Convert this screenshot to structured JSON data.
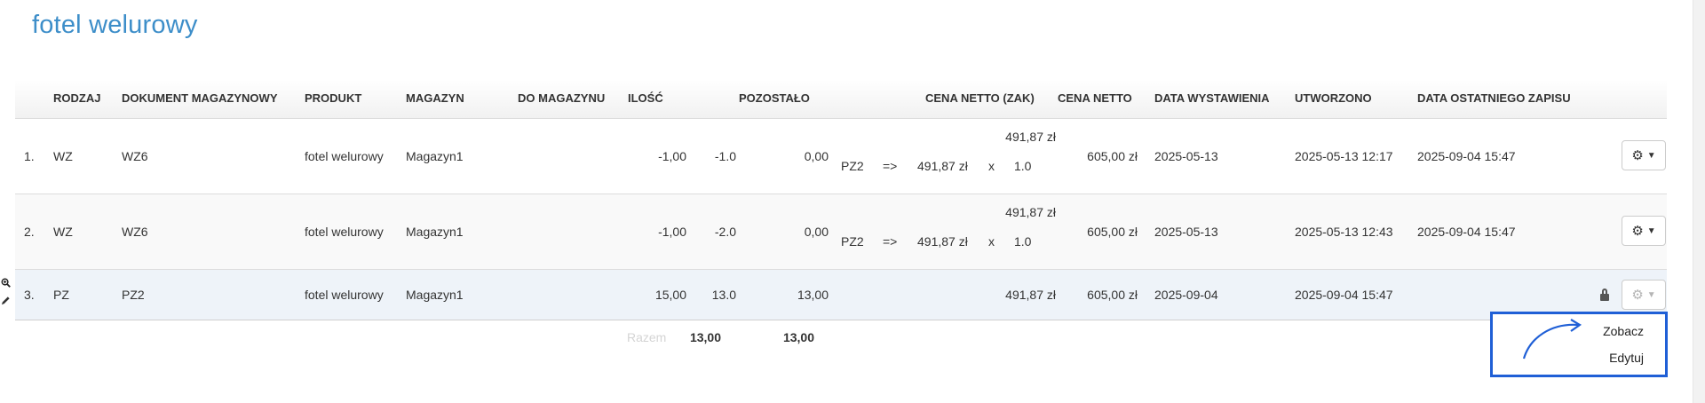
{
  "page_title": "fotel welurowy",
  "headers": {
    "rodzaj": "RODZAJ",
    "dokument": "DOKUMENT MAGAZYNOWY",
    "produkt": "PRODUKT",
    "magazyn": "MAGAZYN",
    "do_magazynu": "DO MAGAZYNU",
    "ilosc": "ILOŚĆ",
    "pozostalo": "POZOSTAŁO",
    "cena_zak": "CENA NETTO (ZAK)",
    "cena_netto": "CENA NETTO",
    "data_wystawienia": "DATA WYSTAWIENIA",
    "utworzono": "UTWORZONO",
    "data_zapisu": "DATA OSTATNIEGO ZAPISU"
  },
  "rows": [
    {
      "num": "1.",
      "rodzaj": "WZ",
      "dokument": "WZ6",
      "produkt": "fotel welurowy",
      "magazyn": "Magazyn1",
      "ilosc": "-1,00",
      "running": "-1.0",
      "pozostalo": "0,00",
      "zak_top": "491,87 zł",
      "zak_src": "PZ2",
      "zak_arrow": "=>",
      "zak_price": "491,87 zł",
      "zak_x": "x",
      "zak_qty": "1.0",
      "cena_netto": "605,00 zł",
      "data_wystawienia": "2025-05-13",
      "utworzono": "2025-05-13 12:17",
      "data_zapisu": "2025-09-04 15:47"
    },
    {
      "num": "2.",
      "rodzaj": "WZ",
      "dokument": "WZ6",
      "produkt": "fotel welurowy",
      "magazyn": "Magazyn1",
      "ilosc": "-1,00",
      "running": "-2.0",
      "pozostalo": "0,00",
      "zak_top": "491,87 zł",
      "zak_src": "PZ2",
      "zak_arrow": "=>",
      "zak_price": "491,87 zł",
      "zak_x": "x",
      "zak_qty": "1.0",
      "cena_netto": "605,00 zł",
      "data_wystawienia": "2025-05-13",
      "utworzono": "2025-05-13 12:43",
      "data_zapisu": "2025-09-04 15:47"
    },
    {
      "num": "3.",
      "rodzaj": "PZ",
      "dokument": "PZ2",
      "produkt": "fotel welurowy",
      "magazyn": "Magazyn1",
      "ilosc": "15,00",
      "running": "13.0",
      "pozostalo": "13,00",
      "zak_top": "491,87 zł",
      "cena_netto": "605,00 zł",
      "data_wystawienia": "2025-09-04",
      "utworzono": "2025-09-04 15:47",
      "data_zapisu": ""
    }
  ],
  "totals": {
    "label": "Razem",
    "running": "13,00",
    "pozostalo": "13,00"
  },
  "menu": {
    "zobacz": "Zobacz",
    "edytuj": "Edytuj"
  },
  "icons": {
    "actions": "gear-icon",
    "caret": "caret-down-icon",
    "lock": "lock-icon",
    "zoom": "zoom-in-icon",
    "edit": "pencil-icon"
  },
  "colors": {
    "title": "#3d8ec9",
    "popup_border": "#1f5fd6",
    "selected_row": "#eef3f9"
  }
}
